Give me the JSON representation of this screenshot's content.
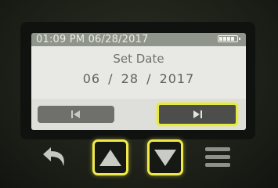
{
  "status_bar": {
    "datetime": "01:09 PM 06/28/2017",
    "battery_icon": "battery-full-icon"
  },
  "screen": {
    "title": "Set Date",
    "date_display": "06 / 28 / 2017"
  },
  "nav": {
    "previous_icon": "skip-previous-icon",
    "next_icon": "skip-next-icon"
  },
  "hardware_buttons": {
    "back_icon": "back-arrow-icon",
    "up_icon": "up-arrow-icon",
    "down_icon": "down-arrow-icon",
    "menu_icon": "menu-icon"
  },
  "colors": {
    "highlight": "#e7e93b",
    "screen_background": "#e8e9e5",
    "status_bar": "#8f958b"
  }
}
